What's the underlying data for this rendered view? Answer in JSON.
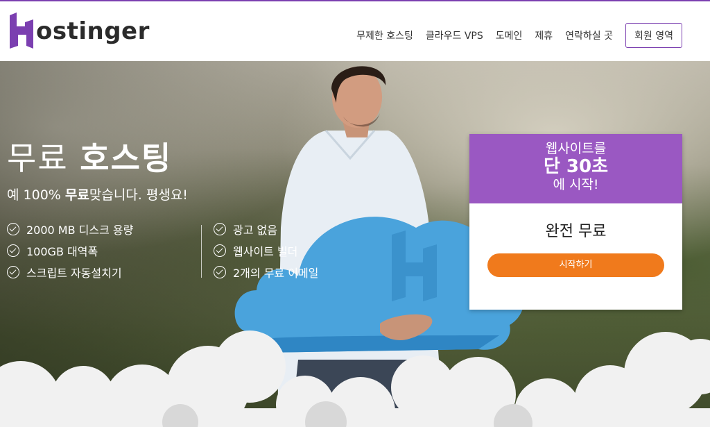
{
  "header": {
    "logo_text": "ostinger",
    "nav": [
      {
        "label": "무제한 호스팅"
      },
      {
        "label": "클라우드 VPS"
      },
      {
        "label": "도메인"
      },
      {
        "label": "제휴"
      },
      {
        "label": "연락하실 곳"
      }
    ],
    "member_button": "회원 영역"
  },
  "hero": {
    "title_light": "무료 ",
    "title_bold": "호스팅",
    "subtitle_prefix": "예 100% ",
    "subtitle_bold": "무료",
    "subtitle_suffix": "맞습니다. 평생요!",
    "features_left": [
      "2000 MB 디스크 용량",
      "100GB 대역폭",
      "스크립트 자동설치기"
    ],
    "features_right": [
      "광고 없음",
      "웹사이트 빌더",
      "2개의 무료 이메일"
    ]
  },
  "promo": {
    "line1": "웹사이트를",
    "line2": "단 30초",
    "line3": "에 시작!",
    "free_text": "완전 무료",
    "cta_label": "시작하기"
  },
  "colors": {
    "brand_purple": "#7b3fb0",
    "promo_purple": "#9a58c2",
    "cta_orange": "#f07a1c"
  },
  "icons": {
    "logo": "hostinger-h-logo",
    "feature": "check-circle-icon"
  }
}
